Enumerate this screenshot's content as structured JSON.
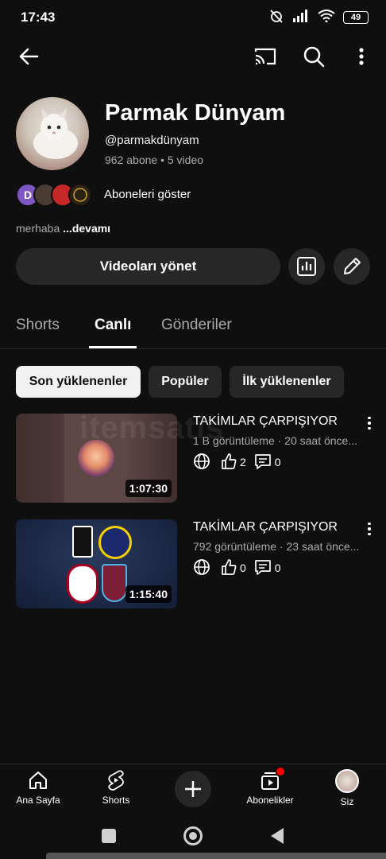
{
  "status_bar": {
    "time": "17:43",
    "battery": "49"
  },
  "channel": {
    "name": "Parmak Dünyam",
    "handle": "@parmakdünyam",
    "subscribers": "962 abone",
    "videos": "5 video",
    "separator": "•",
    "subscriber_avatar_letter": "D",
    "show_subscribers_label": "Aboneleri göster",
    "description": "merhaba",
    "description_more": "...devamı"
  },
  "actions": {
    "manage_videos": "Videoları yönet"
  },
  "tabs": [
    {
      "label": "Shorts",
      "active": false
    },
    {
      "label": "Canlı",
      "active": true
    },
    {
      "label": "Gönderiler",
      "active": false
    }
  ],
  "chips": [
    {
      "label": "Son yüklenenler",
      "selected": true
    },
    {
      "label": "Popüler",
      "selected": false
    },
    {
      "label": "İlk yüklenenler",
      "selected": false
    }
  ],
  "watermark": "itemsatis",
  "videos": [
    {
      "title": "TAKİMLAR ÇARPIŞIYOR",
      "meta": "1 B görüntüleme · 20 saat önce...",
      "duration": "1:07:30",
      "likes": "2",
      "comments": "0"
    },
    {
      "title": "TAKİMLAR ÇARPIŞIYOR",
      "meta": "792 görüntüleme · 23 saat önce...",
      "duration": "1:15:40",
      "likes": "0",
      "comments": "0"
    }
  ],
  "bottom_nav": {
    "home": "Ana Sayfa",
    "shorts": "Shorts",
    "subscriptions": "Abonelikler",
    "you": "Siz"
  },
  "colors": {
    "background": "#0f0f0f",
    "surface": "#272727",
    "text": "#f1f1f1",
    "secondary_text": "#aaaaaa",
    "notification_dot": "#ff0000"
  }
}
